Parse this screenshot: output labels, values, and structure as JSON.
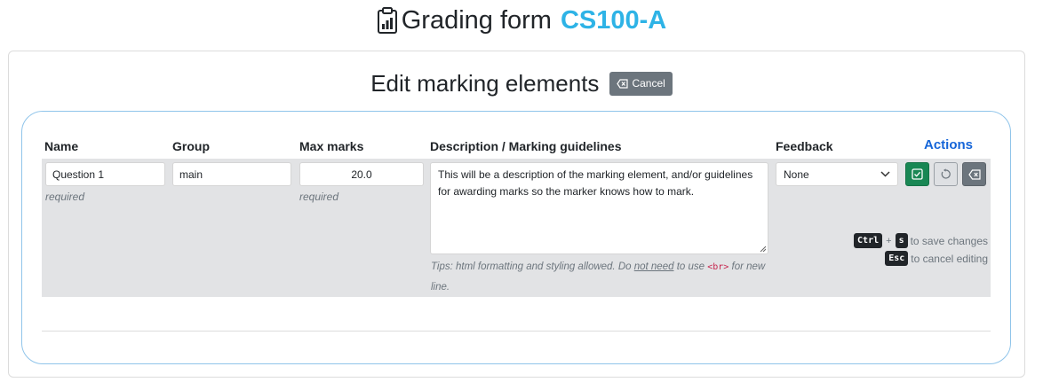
{
  "header": {
    "title": "Grading form",
    "course_code": "CS100-A"
  },
  "edit": {
    "title": "Edit marking elements",
    "cancel_label": "Cancel"
  },
  "columns": {
    "name": "Name",
    "group": "Group",
    "max_marks": "Max marks",
    "description": "Description / Marking guidelines",
    "feedback": "Feedback",
    "actions": "Actions"
  },
  "row": {
    "name_value": "Question 1",
    "name_hint": "required",
    "group_value": "main",
    "max_marks_value": "20.0",
    "max_marks_hint": "required",
    "description_value": "This will be a description of the marking element, and/or guidelines for awarding marks  so the marker knows how to mark.",
    "feedback_selected": "None"
  },
  "tips": {
    "prefix": "Tips: html formatting and styling allowed. Do ",
    "emphasis": "not need",
    "middle": " to use ",
    "code": "<br>",
    "suffix": " for new line."
  },
  "shortcuts": {
    "ctrl": "Ctrl",
    "plus": "+",
    "s": "s",
    "save_text": "to save changes",
    "esc": "Esc",
    "cancel_text": "to cancel editing"
  },
  "icons": {
    "title_icon": "clipboard-data-icon",
    "cancel_icon": "backspace-icon",
    "save_icon": "check-square-icon",
    "reset_icon": "refresh-icon",
    "remove_icon": "backspace-icon",
    "select_icon": "chevron-down-icon"
  },
  "colors": {
    "accent": "#2eb3e6",
    "actions_heading": "#1565d8",
    "save": "#198754",
    "secondary": "#6c757d"
  }
}
